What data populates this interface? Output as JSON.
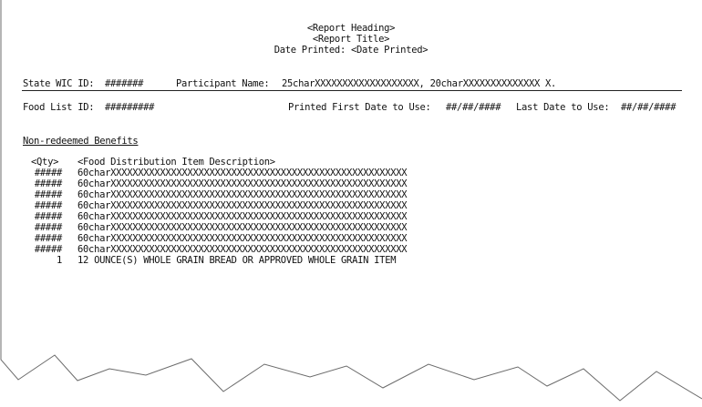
{
  "header": {
    "report_heading": "<Report Heading>",
    "report_title": "<Report Title>",
    "date_printed": "Date Printed: <Date Printed>"
  },
  "participant": {
    "state_wic_id_label": "State WIC ID:",
    "state_wic_id_value": "#######",
    "participant_name_label": "Participant Name:",
    "participant_name_value": "25charXXXXXXXXXXXXXXXXXXX, 20charXXXXXXXXXXXXXX X."
  },
  "food_list": {
    "food_list_id_label": "Food List ID:",
    "food_list_id_value": "#########",
    "first_date_label": "Printed First Date to Use:",
    "first_date_value": "##/##/####",
    "last_date_label": "Last Date to Use:",
    "last_date_value": "##/##/####"
  },
  "section_title": "Non-redeemed Benefits",
  "table": {
    "qty_header": "<Qty>",
    "desc_header": "<Food Distribution Item Description>",
    "rows": [
      {
        "qty": "#####",
        "desc": "60charXXXXXXXXXXXXXXXXXXXXXXXXXXXXXXXXXXXXXXXXXXXXXXXXXXXXXX"
      },
      {
        "qty": "#####",
        "desc": "60charXXXXXXXXXXXXXXXXXXXXXXXXXXXXXXXXXXXXXXXXXXXXXXXXXXXXXX"
      },
      {
        "qty": "#####",
        "desc": "60charXXXXXXXXXXXXXXXXXXXXXXXXXXXXXXXXXXXXXXXXXXXXXXXXXXXXXX"
      },
      {
        "qty": "#####",
        "desc": "60charXXXXXXXXXXXXXXXXXXXXXXXXXXXXXXXXXXXXXXXXXXXXXXXXXXXXXX"
      },
      {
        "qty": "#####",
        "desc": "60charXXXXXXXXXXXXXXXXXXXXXXXXXXXXXXXXXXXXXXXXXXXXXXXXXXXXXX"
      },
      {
        "qty": "#####",
        "desc": "60charXXXXXXXXXXXXXXXXXXXXXXXXXXXXXXXXXXXXXXXXXXXXXXXXXXXXXX"
      },
      {
        "qty": "#####",
        "desc": "60charXXXXXXXXXXXXXXXXXXXXXXXXXXXXXXXXXXXXXXXXXXXXXXXXXXXXXX"
      },
      {
        "qty": "#####",
        "desc": "60charXXXXXXXXXXXXXXXXXXXXXXXXXXXXXXXXXXXXXXXXXXXXXXXXXXXXXX"
      },
      {
        "qty": "1",
        "desc": "12 OUNCE(S) WHOLE GRAIN BREAD OR APPROVED WHOLE GRAIN ITEM"
      }
    ]
  }
}
